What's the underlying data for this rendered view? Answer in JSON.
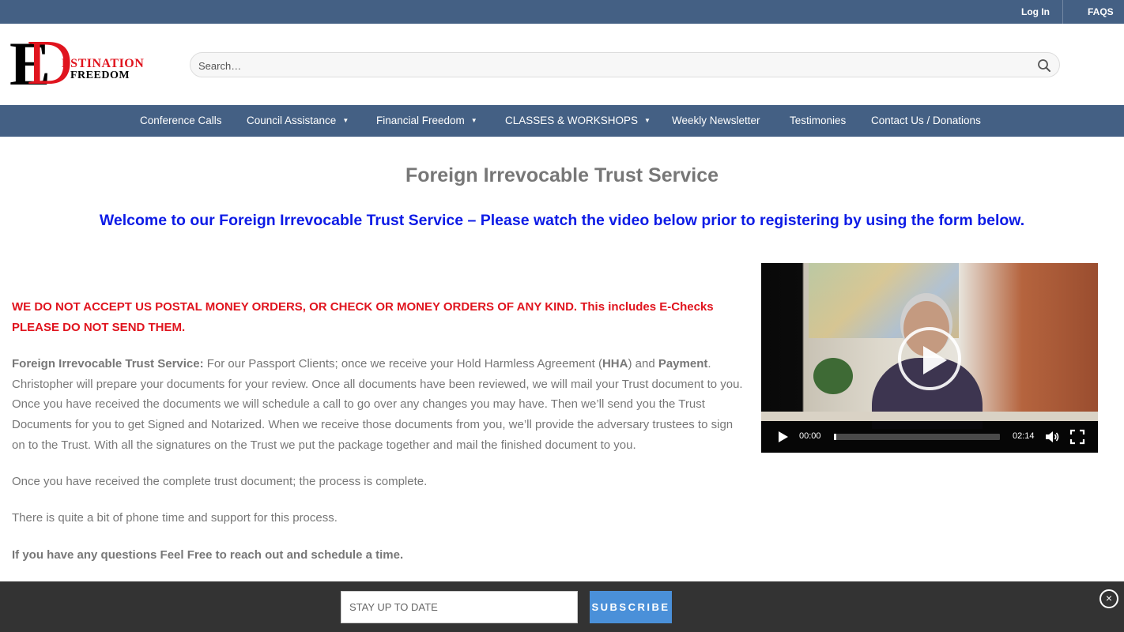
{
  "topbar": {
    "login_label": "Log In",
    "faqs_label": "FAQS",
    "bg_color": "#446084"
  },
  "brand": {
    "logo_e": "E",
    "logo_d": "D",
    "logo_line1": "ESTINATION",
    "logo_line2": "FREEDOM",
    "red": "#e0141e"
  },
  "search": {
    "placeholder": "Search…",
    "icon": "search-icon"
  },
  "nav": {
    "items": [
      {
        "label": "Conference Calls",
        "has_dropdown": false
      },
      {
        "label": "Council Assistance",
        "has_dropdown": true
      },
      {
        "label": "Financial Freedom",
        "has_dropdown": true
      },
      {
        "label": "CLASSES & WORKSHOPS",
        "has_dropdown": true
      },
      {
        "label": "Weekly Newsletter",
        "has_dropdown": false
      },
      {
        "label": "Testimonies",
        "has_dropdown": false
      },
      {
        "label": "Contact Us / Donations",
        "has_dropdown": false
      }
    ],
    "caret": "▼"
  },
  "main": {
    "title": "Foreign Irrevocable Trust Service",
    "welcome": "Welcome to our Foreign Irrevocable Trust Service – Please watch the video below prior to registering by using the form below.",
    "warning": "WE DO NOT ACCEPT US POSTAL MONEY ORDERS, OR CHECK OR MONEY ORDERS OF ANY KIND. This includes E-Checks PLEASE DO NOT SEND THEM.",
    "service_label": "Foreign Irrevocable Trust Service:",
    "service_text_1": " For our Passport Clients; once we receive your Hold Harmless Agreement (",
    "hha": "HHA",
    "service_text_2": ") and ",
    "payment": "Payment",
    "service_text_3": ". Christopher will prepare your documents for your review. Once all documents have been reviewed, we will mail your Trust document to you. Once you have received the documents we will schedule a call to go over any changes you may have. Then we’ll send you the Trust Documents for you to get Signed and Notarized. When we receive those documents from you, we’ll provide the adversary trustees to sign on to the Trust. With all the signatures on the Trust we put the package together and mail the finished document to you.",
    "complete_text": "Once you have received the complete trust document; the process is complete.",
    "support_text": "There is quite a bit of phone time and support for this process.",
    "questions_text": "If you have any questions Feel Free to reach out and schedule a time."
  },
  "video": {
    "current_time": "00:00",
    "duration": "02:14",
    "progress": 0.01,
    "icons": [
      "play-icon",
      "volume-icon",
      "fullscreen-icon"
    ]
  },
  "subscribe": {
    "placeholder": "STAY UP TO DATE",
    "button_label": "SUBSCRIBE",
    "close_glyph": "×",
    "button_color": "#4a90d9"
  }
}
